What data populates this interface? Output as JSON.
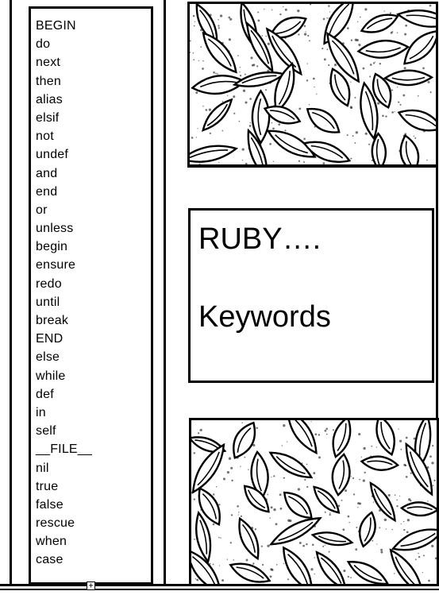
{
  "keywords": [
    "BEGIN",
    "do",
    "next",
    "then",
    "alias",
    "elsif",
    "not",
    "undef",
    "and",
    "end",
    "or",
    "unless",
    "begin",
    "ensure",
    "redo",
    "until",
    "break",
    "END",
    "else",
    "while",
    "def",
    "in",
    "self",
    "__FILE__",
    "nil",
    "true",
    "false",
    "rescue",
    "when",
    "case"
  ],
  "title": {
    "line1": "RUBY….",
    "line2": "Keywords"
  },
  "decoration": {
    "pattern": "leaf-pattern",
    "ink_color": "#000000",
    "paper_color": "#ffffff"
  },
  "handle_icon": "plus-square-icon",
  "handle_glyph": "+"
}
